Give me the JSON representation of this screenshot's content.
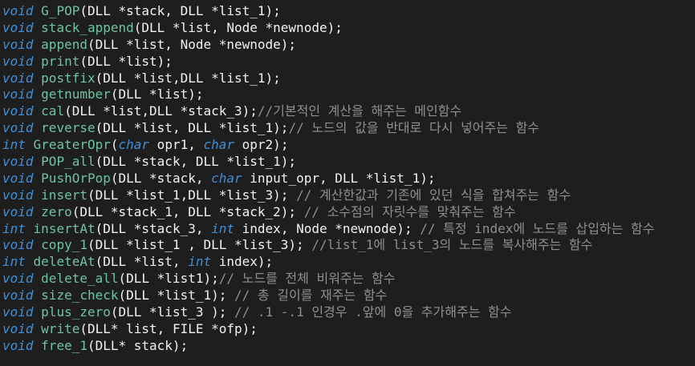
{
  "editor": {
    "colors": {
      "background": "#1e1e1e",
      "keyword": "#3f8fd6",
      "function": "#6ec49f",
      "comment": "#8f8f8f",
      "text": "#f2f2f2"
    },
    "lines": [
      [
        {
          "k": "kw",
          "t": "void"
        },
        {
          "k": "tx",
          "t": " "
        },
        {
          "k": "fn",
          "t": "G_POP"
        },
        {
          "k": "tx",
          "t": "(DLL *stack, DLL *list_1);"
        }
      ],
      [
        {
          "k": "kw",
          "t": "void"
        },
        {
          "k": "tx",
          "t": " "
        },
        {
          "k": "fn",
          "t": "stack_append"
        },
        {
          "k": "tx",
          "t": "(DLL *list, Node *newnode);"
        }
      ],
      [
        {
          "k": "kw",
          "t": "void"
        },
        {
          "k": "tx",
          "t": " "
        },
        {
          "k": "fn",
          "t": "append"
        },
        {
          "k": "tx",
          "t": "(DLL *list, Node *newnode);"
        }
      ],
      [
        {
          "k": "kw",
          "t": "void"
        },
        {
          "k": "tx",
          "t": " "
        },
        {
          "k": "fn",
          "t": "print"
        },
        {
          "k": "tx",
          "t": "(DLL *list);"
        }
      ],
      [
        {
          "k": "kw",
          "t": "void"
        },
        {
          "k": "tx",
          "t": " "
        },
        {
          "k": "fn",
          "t": "postfix"
        },
        {
          "k": "tx",
          "t": "(DLL *list,DLL *list_1);"
        }
      ],
      [
        {
          "k": "kw",
          "t": "void"
        },
        {
          "k": "tx",
          "t": " "
        },
        {
          "k": "fn",
          "t": "getnumber"
        },
        {
          "k": "tx",
          "t": "(DLL *list);"
        }
      ],
      [
        {
          "k": "kw",
          "t": "void"
        },
        {
          "k": "tx",
          "t": " "
        },
        {
          "k": "fn",
          "t": "cal"
        },
        {
          "k": "tx",
          "t": "(DLL *list,DLL *stack_3);"
        },
        {
          "k": "cm",
          "t": "//기본적인 계산을 해주는 메인함수"
        }
      ],
      [
        {
          "k": "kw",
          "t": "void"
        },
        {
          "k": "tx",
          "t": " "
        },
        {
          "k": "fn",
          "t": "reverse"
        },
        {
          "k": "tx",
          "t": "(DLL *list, DLL *list_1);"
        },
        {
          "k": "cm",
          "t": "// 노드의 값을 반대로 다시 넣어주는 함수"
        }
      ],
      [
        {
          "k": "kw",
          "t": "int"
        },
        {
          "k": "tx",
          "t": " "
        },
        {
          "k": "fn",
          "t": "GreaterOpr"
        },
        {
          "k": "tx",
          "t": "("
        },
        {
          "k": "kw",
          "t": "char"
        },
        {
          "k": "tx",
          "t": " opr1, "
        },
        {
          "k": "kw",
          "t": "char"
        },
        {
          "k": "tx",
          "t": " opr2);"
        }
      ],
      [
        {
          "k": "kw",
          "t": "void"
        },
        {
          "k": "tx",
          "t": " "
        },
        {
          "k": "fn",
          "t": "POP_all"
        },
        {
          "k": "tx",
          "t": "(DLL *stack, DLL *list_1);"
        }
      ],
      [
        {
          "k": "kw",
          "t": "void"
        },
        {
          "k": "tx",
          "t": " "
        },
        {
          "k": "fn",
          "t": "PushOrPop"
        },
        {
          "k": "tx",
          "t": "(DLL *stack, "
        },
        {
          "k": "kw",
          "t": "char"
        },
        {
          "k": "tx",
          "t": " input_opr, DLL *list_1);"
        }
      ],
      [
        {
          "k": "kw",
          "t": "void"
        },
        {
          "k": "tx",
          "t": " "
        },
        {
          "k": "fn",
          "t": "insert"
        },
        {
          "k": "tx",
          "t": "(DLL *list_1,DLL *list_3); "
        },
        {
          "k": "cm",
          "t": "// 계산한값과 기존에 있던 식을 합쳐주는 함수"
        }
      ],
      [
        {
          "k": "kw",
          "t": "void"
        },
        {
          "k": "tx",
          "t": " "
        },
        {
          "k": "fn",
          "t": "zero"
        },
        {
          "k": "tx",
          "t": "(DLL *stack_1, DLL *stack_2); "
        },
        {
          "k": "cm",
          "t": "// 소수점의 자릿수를 맞춰주는 함수"
        }
      ],
      [
        {
          "k": "kw",
          "t": "int"
        },
        {
          "k": "tx",
          "t": " "
        },
        {
          "k": "fn",
          "t": "insertAt"
        },
        {
          "k": "tx",
          "t": "(DLL *stack_3, "
        },
        {
          "k": "kw",
          "t": "int"
        },
        {
          "k": "tx",
          "t": " index, Node *newnode); "
        },
        {
          "k": "cm",
          "t": "// 특정 index에 노드를 삽입하는 함수"
        }
      ],
      [
        {
          "k": "kw",
          "t": "void"
        },
        {
          "k": "tx",
          "t": " "
        },
        {
          "k": "fn",
          "t": "copy_1"
        },
        {
          "k": "tx",
          "t": "(DLL *list_1 , DLL *list_3); "
        },
        {
          "k": "cm",
          "t": "//list_1에 list_3의 노드를 복사해주는 함수"
        }
      ],
      [
        {
          "k": "kw",
          "t": "int"
        },
        {
          "k": "tx",
          "t": " "
        },
        {
          "k": "fn",
          "t": "deleteAt"
        },
        {
          "k": "tx",
          "t": "(DLL *list, "
        },
        {
          "k": "kw",
          "t": "int"
        },
        {
          "k": "tx",
          "t": " index);"
        }
      ],
      [
        {
          "k": "kw",
          "t": "void"
        },
        {
          "k": "tx",
          "t": " "
        },
        {
          "k": "fn",
          "t": "delete_all"
        },
        {
          "k": "tx",
          "t": "(DLL *list1);"
        },
        {
          "k": "cm",
          "t": "// 노드를 전체 비워주는 함수"
        }
      ],
      [
        {
          "k": "kw",
          "t": "void"
        },
        {
          "k": "tx",
          "t": " "
        },
        {
          "k": "fn",
          "t": "size_check"
        },
        {
          "k": "tx",
          "t": "(DLL *list_1); "
        },
        {
          "k": "cm",
          "t": "// 총 길이를 재주는 함수"
        }
      ],
      [
        {
          "k": "kw",
          "t": "void"
        },
        {
          "k": "tx",
          "t": " "
        },
        {
          "k": "fn",
          "t": "plus_zero"
        },
        {
          "k": "tx",
          "t": "(DLL *list_3 ); "
        },
        {
          "k": "cm",
          "t": "// .1 -.1 인경우 .앞에 0을 추가해주는 함수"
        }
      ],
      [
        {
          "k": "kw",
          "t": "void"
        },
        {
          "k": "tx",
          "t": " "
        },
        {
          "k": "fn",
          "t": "write"
        },
        {
          "k": "tx",
          "t": "(DLL* list, FILE *ofp);"
        }
      ],
      [
        {
          "k": "kw",
          "t": "void"
        },
        {
          "k": "tx",
          "t": " "
        },
        {
          "k": "fn",
          "t": "free_1"
        },
        {
          "k": "tx",
          "t": "(DLL* stack);"
        }
      ]
    ]
  }
}
